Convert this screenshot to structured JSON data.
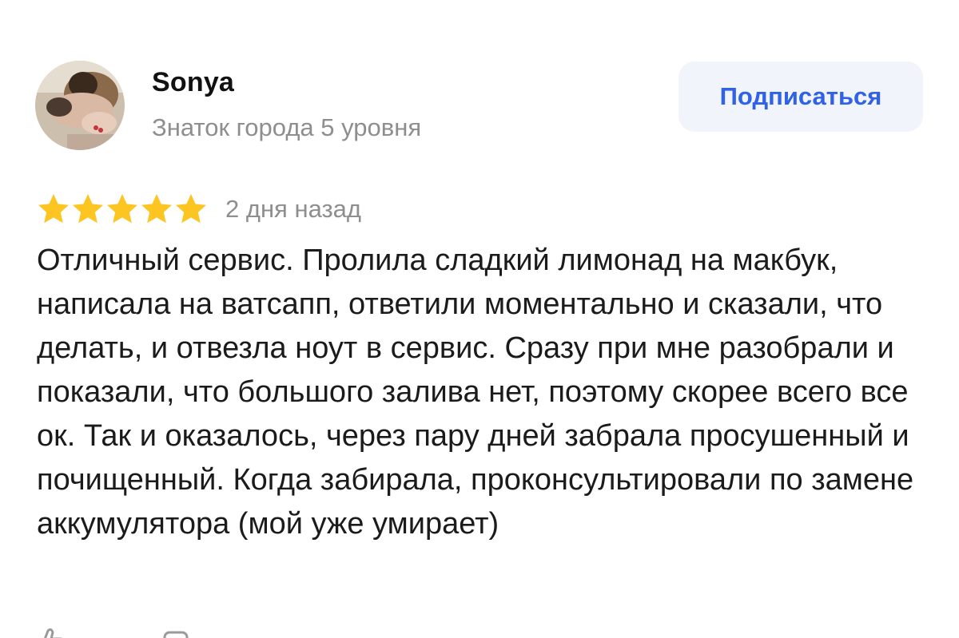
{
  "author": {
    "name": "Sonya",
    "level": "Знаток города 5 уровня"
  },
  "subscribe": {
    "label": "Подписаться"
  },
  "review": {
    "rating": 5,
    "rating_max": 5,
    "date": "2 дня назад",
    "text": "Отличный сервис. Пролила сладкий лимонад на макбук, написала на ватсапп, ответили моментально и сказали, что делать, и отвезла ноут в сервис. Сразу при мне разобрали и показали, что большого залива нет, поэтому скорее всего все ок. Так и оказалось, через пару дней забрала просушенный и почищенный. Когда забирала, проконсультировали по замене аккумулятора (мой уже умирает)"
  },
  "colors": {
    "accent": "#2f62e6",
    "button_bg": "#f1f4fa",
    "star": "#fcc521",
    "muted_text": "#8e8e8e"
  },
  "icons": {
    "star": "star-icon",
    "like": "like-icon",
    "comment": "comment-icon"
  }
}
